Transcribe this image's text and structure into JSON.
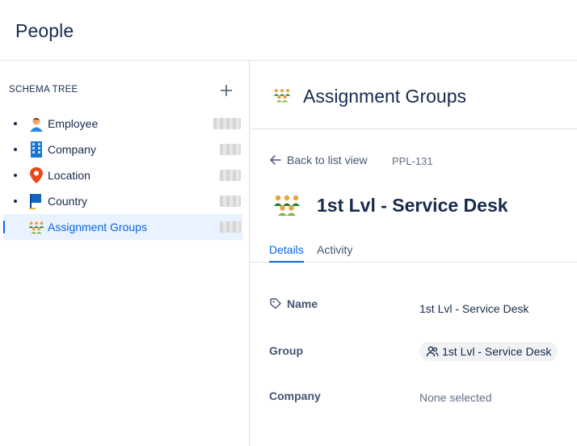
{
  "page": {
    "title": "People"
  },
  "sidebar": {
    "heading": "SCHEMA TREE",
    "add_icon": "plus-icon",
    "items": [
      {
        "label": "Employee",
        "icon": "person-icon",
        "active": false
      },
      {
        "label": "Company",
        "icon": "building-icon",
        "active": false
      },
      {
        "label": "Location",
        "icon": "map-pin-icon",
        "active": false
      },
      {
        "label": "Country",
        "icon": "flag-icon",
        "active": false
      },
      {
        "label": "Assignment Groups",
        "icon": "group-icon",
        "active": true
      }
    ]
  },
  "main": {
    "header_title": "Assignment Groups",
    "header_icon": "group-icon",
    "back_label": "Back to list view",
    "object_key": "PPL-131",
    "object_title": "1st Lvl - Service Desk",
    "tabs": [
      {
        "label": "Details",
        "active": true
      },
      {
        "label": "Activity",
        "active": false
      }
    ],
    "attributes": [
      {
        "label": "Name",
        "value": "1st Lvl - Service Desk",
        "icon": "tag-icon"
      },
      {
        "label": "Group",
        "value": "1st Lvl - Service Desk",
        "icon": "people-icon"
      },
      {
        "label": "Company",
        "value": "None selected"
      }
    ]
  },
  "colors": {
    "accent": "#0c66e4",
    "active_bg": "#e9f2ff",
    "text": "#172b4d",
    "subtle": "#44546f"
  }
}
